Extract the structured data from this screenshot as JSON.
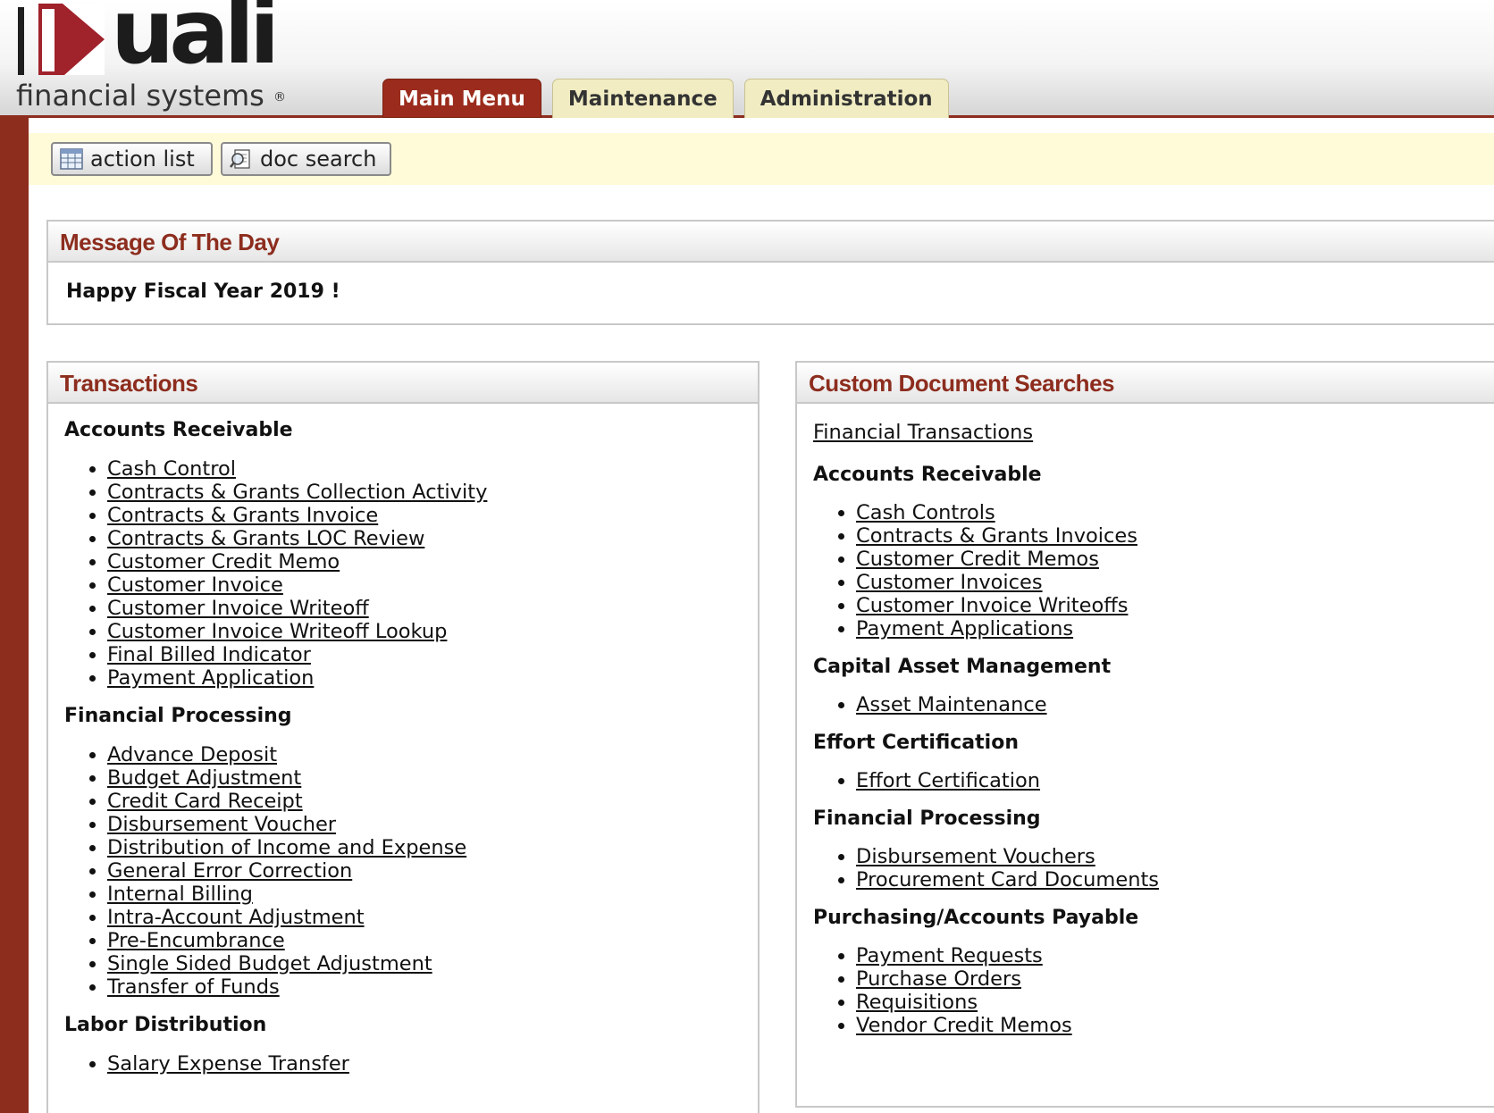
{
  "header": {
    "logo_word": "uali",
    "logo_tagline": "financial systems",
    "logo_registered": "®",
    "tabs": [
      {
        "label": "Main Menu",
        "active": true
      },
      {
        "label": "Maintenance",
        "active": false
      },
      {
        "label": "Administration",
        "active": false
      }
    ]
  },
  "toolbar": {
    "action_list": {
      "label": "action list",
      "icon": "table-icon"
    },
    "doc_search": {
      "label": "doc search",
      "icon": "magnifier-document-icon"
    }
  },
  "motd": {
    "title": "Message Of The Day",
    "text": "Happy Fiscal Year 2019 !"
  },
  "transactions": {
    "title": "Transactions",
    "groups": [
      {
        "name": "Accounts Receivable",
        "items": [
          "Cash Control",
          "Contracts & Grants Collection Activity",
          "Contracts & Grants Invoice",
          "Contracts & Grants LOC Review",
          "Customer Credit Memo",
          "Customer Invoice",
          "Customer Invoice Writeoff",
          "Customer Invoice Writeoff Lookup",
          "Final Billed Indicator",
          "Payment Application"
        ]
      },
      {
        "name": "Financial Processing",
        "items": [
          "Advance Deposit",
          "Budget Adjustment",
          "Credit Card Receipt",
          "Disbursement Voucher",
          "Distribution of Income and Expense",
          "General Error Correction",
          "Internal Billing",
          "Intra-Account Adjustment",
          "Pre-Encumbrance",
          "Single Sided Budget Adjustment",
          "Transfer of Funds"
        ]
      },
      {
        "name": "Labor Distribution",
        "items": [
          "Salary Expense Transfer"
        ]
      }
    ]
  },
  "custom_searches": {
    "title": "Custom Document Searches",
    "top_link": "Financial Transactions",
    "groups": [
      {
        "name": "Accounts Receivable",
        "items": [
          "Cash Controls",
          "Contracts & Grants Invoices",
          "Customer Credit Memos",
          "Customer Invoices",
          "Customer Invoice Writeoffs",
          "Payment Applications"
        ]
      },
      {
        "name": "Capital Asset Management",
        "items": [
          "Asset Maintenance"
        ]
      },
      {
        "name": "Effort Certification",
        "items": [
          "Effort Certification"
        ]
      },
      {
        "name": "Financial Processing",
        "items": [
          "Disbursement Vouchers",
          "Procurement Card Documents"
        ]
      },
      {
        "name": "Purchasing/Accounts Payable",
        "items": [
          "Payment Requests",
          "Purchase Orders",
          "Requisitions",
          "Vendor Credit Memos"
        ]
      }
    ]
  }
}
